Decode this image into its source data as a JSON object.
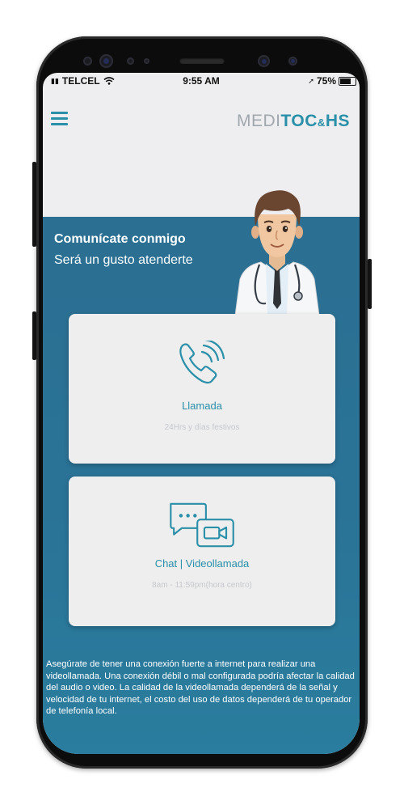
{
  "statusbar": {
    "carrier": "TELCEL",
    "time": "9:55 AM",
    "battery": "75%"
  },
  "header": {
    "logo_part1": "MEDI",
    "logo_part2": "TOC",
    "logo_amp": "&",
    "logo_part3": "HS"
  },
  "hero": {
    "title": "Comunícate conmigo",
    "subtitle": "Será un gusto atenderte"
  },
  "options": [
    {
      "title": "Llamada",
      "subtitle": "24Hrs y días festivos",
      "icon": "phone-ringing-icon"
    },
    {
      "title": "Chat | Videollamada",
      "subtitle": "8am - 11:59pm(hora centro)",
      "icon": "chat-video-icon"
    }
  ],
  "footer_note": "Asegúrate de tener una conexión fuerte a internet para realizar una videollamada. Una conexión débil o mal configurada podría afectar la calidad del audio o video.  La calidad de la videollamada dependerá de la señal y velocidad de tu internet, el costo del uso de datos dependerá de tu operador de telefonía local.",
  "colors": {
    "accent": "#2a8fa8",
    "hero_bg": "#2b6f92",
    "card_bg": "#eeeeef",
    "screen_bg": "#eeeef0"
  }
}
